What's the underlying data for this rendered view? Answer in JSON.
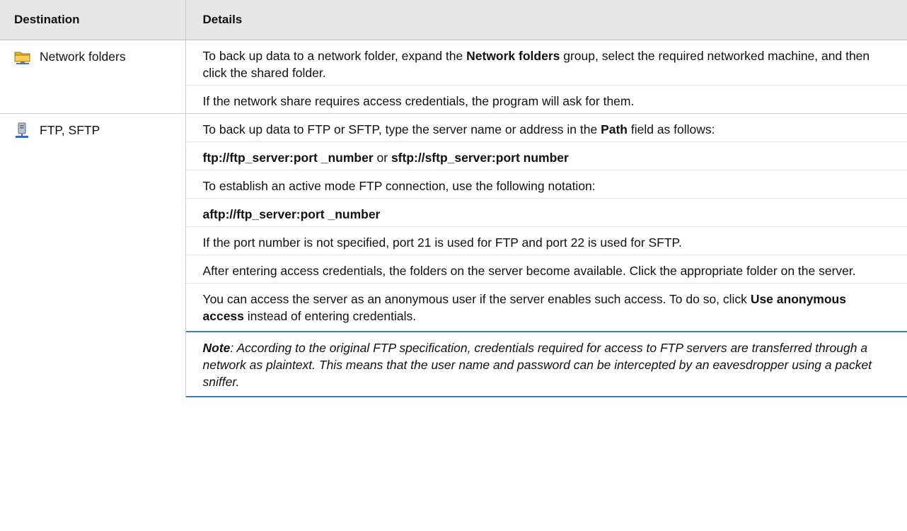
{
  "header": {
    "col1": "Destination",
    "col2": "Details"
  },
  "rows": [
    {
      "icon": "network-folder-icon",
      "label": "Network folders",
      "p1": {
        "a": "To back up data to a network folder, expand the ",
        "b": "Network folders",
        "c": " group, select the required networked machine, and then click the shared folder."
      },
      "p2": "If the network share requires access credentials, the program will ask for them."
    },
    {
      "icon": "ftp-server-icon",
      "label": "FTP, SFTP",
      "p1": {
        "a": "To back up data to FTP or SFTP, type the server name or address in the ",
        "b": "Path",
        "c": " field as follows:"
      },
      "p2": {
        "a": "ftp://ftp_server:port _number",
        "b": " or ",
        "c": "sftp://sftp_server:port number"
      },
      "p3": "To establish an active mode FTP connection, use the following notation:",
      "p4": "aftp://ftp_server:port _number",
      "p5": "If the port number is not specified, port 21 is used for FTP and port 22 is used for SFTP.",
      "p6": "After entering access credentials, the folders on the server become available. Click the appropriate folder on the server.",
      "p7": {
        "a": "You can access the server as an anonymous user if the server enables such access. To do so, click ",
        "b": "Use anonymous access",
        "c": " instead of entering credentials."
      },
      "note": {
        "label": "Note",
        "text": ": According to the original FTP specification, credentials required for access to FTP servers are transferred through a network as plaintext. This means that the user name and password can be intercepted by an eavesdropper using a packet sniffer."
      }
    }
  ],
  "colors": {
    "header_bg": "#e6e6e6",
    "note_border": "#3f7fb8",
    "grid": "#cfcfcf"
  }
}
